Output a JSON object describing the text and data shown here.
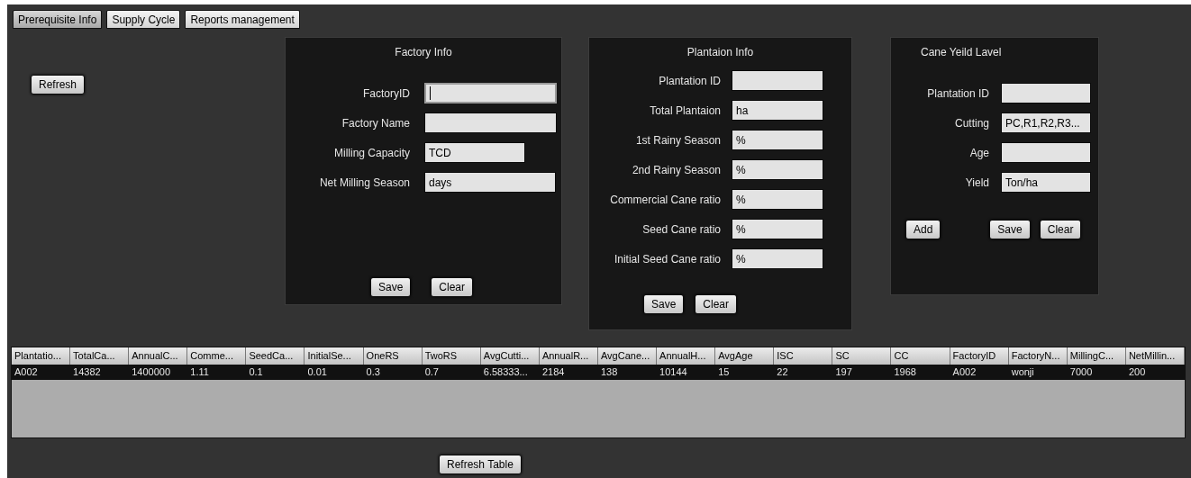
{
  "tabs": [
    {
      "label": "Prerequisite Info",
      "selected": true
    },
    {
      "label": "Supply Cycle",
      "selected": false
    },
    {
      "label": "Reports management",
      "selected": false
    }
  ],
  "refresh_button": "Refresh",
  "factory_info": {
    "title": "Factory Info",
    "fields": [
      {
        "label": "FactoryID",
        "focused": true
      },
      {
        "label": "Factory Name",
        "focused": false
      },
      {
        "label": "Milling Capacity",
        "value": "TCD",
        "focused": false
      },
      {
        "label": "Net Milling Season",
        "value": "days",
        "focused": false
      }
    ],
    "buttons": [
      "Save",
      "Clear"
    ]
  },
  "plantation_info": {
    "title": "Plantaion Info",
    "fields": [
      {
        "label": "Plantation ID",
        "focused": false
      },
      {
        "label": "Total Plantaion",
        "value": "ha",
        "focused": false
      },
      {
        "label": "1st Rainy Season",
        "value": "%",
        "focused": false
      },
      {
        "label": "2nd Rainy Season",
        "value": "%",
        "focused": false
      },
      {
        "label": "Commercial Cane ratio",
        "value": "%",
        "focused": false
      },
      {
        "label": "Seed Cane ratio",
        "value": "%",
        "focused": false
      },
      {
        "label": "Initial Seed Cane ratio",
        "value": "%",
        "focused": false
      }
    ],
    "buttons": [
      "Save",
      "Clear"
    ]
  },
  "cane_yield_level": {
    "title": "Cane Yeild Lavel",
    "fields": [
      {
        "label": "Plantation ID",
        "focused": false
      },
      {
        "label": "Cutting",
        "value": "PC,R1,R2,R3...",
        "focused": false
      },
      {
        "label": "Age",
        "focused": false
      },
      {
        "label": "Yield",
        "value": "Ton/ha",
        "focused": false
      }
    ],
    "buttons": [
      "Add",
      "Save",
      "Clear"
    ]
  },
  "table": {
    "columns": [
      "Plantatio...",
      "TotalCa...",
      "AnnualC...",
      "Comme...",
      "SeedCa...",
      "InitialSe...",
      "OneRS",
      "TwoRS",
      "AvgCutti...",
      "AnnualR...",
      "AvgCane...",
      "AnnualH...",
      "AvgAge",
      "ISC",
      "SC",
      "CC",
      "FactoryID",
      "FactoryN...",
      "MillingC...",
      "NetMillin..."
    ],
    "rows": [
      {
        "selected": true,
        "cells": [
          "A002",
          "14382",
          "1400000",
          "1.11",
          "0.1",
          "0.01",
          "0.3",
          "0.7",
          "6.58333...",
          "2184",
          "138",
          "10144",
          "15",
          "22",
          "197",
          "1968",
          "A002",
          "wonji",
          "7000",
          "200"
        ]
      }
    ]
  },
  "refresh_table_button": "Refresh Table"
}
